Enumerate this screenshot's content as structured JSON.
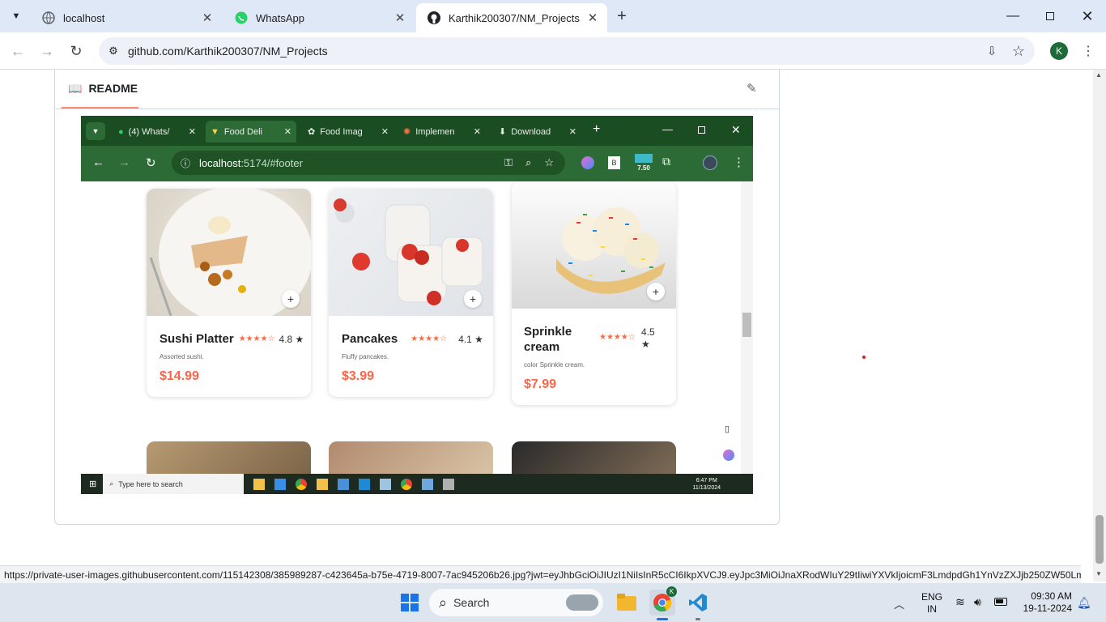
{
  "browser": {
    "tabs": [
      {
        "title": "localhost",
        "icon": "globe-icon"
      },
      {
        "title": "WhatsApp",
        "icon": "whatsapp-icon"
      },
      {
        "title": "Karthik200307/NM_Projects",
        "icon": "github-icon"
      }
    ],
    "address": "github.com/Karthik200307/NM_Projects",
    "profile_initial": "K"
  },
  "readme": {
    "tab_label": "README"
  },
  "screenshot": {
    "tabs": [
      "(4) Whats/",
      "Food Deli",
      "Food Imag",
      "Implemen",
      "Download"
    ],
    "address_host": "localhost",
    "address_rest": ":5174/#footer",
    "ext_badge": "7.50",
    "cards": [
      {
        "name": "Sushi Platter",
        "rating": "4.8 ★",
        "desc": "Assorted sushi.",
        "price": "$14.99"
      },
      {
        "name": "Pancakes",
        "rating": "4.1 ★",
        "desc": "Fluffy pancakes.",
        "price": "$3.99"
      },
      {
        "name": "Sprinkle cream",
        "rating": "4.5 ★",
        "desc": "color Sprinkle cream.",
        "price": "$7.99"
      }
    ],
    "taskbar_search": "Type here to search",
    "taskbar_time": "6:47 PM",
    "taskbar_date": "11/13/2024"
  },
  "status_url": "https://private-user-images.githubusercontent.com/115142308/385989287-c423645a-b75e-4719-8007-7ac945206b26.jpg?jwt=eyJhbGciOiJIUzI1NiIsInR5cCI6IkpXVCJ9.eyJpc3MiOiJnaXRodWIuY29tIiwiYXVkIjoicmF3LmdpdGh1YnVzZXJjb250ZW50LmN...",
  "taskbar": {
    "search_placeholder": "Search",
    "lang1": "ENG",
    "lang2": "IN",
    "time": "09:30 AM",
    "date": "19-11-2024"
  },
  "colors": {
    "accent": "#fd8c73",
    "price": "#ff6347",
    "star": "#ff6a3d",
    "screenshot_chrome": "#1a4d22"
  }
}
